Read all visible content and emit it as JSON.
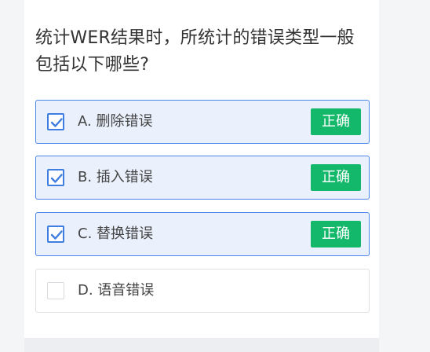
{
  "question": {
    "text": "统计WER结果时，所统计的错误类型一般包括以下哪些?"
  },
  "options": [
    {
      "label": "A. 删除错误",
      "selected": true,
      "badge": "正确"
    },
    {
      "label": "B. 插入错误",
      "selected": true,
      "badge": "正确"
    },
    {
      "label": "C. 替换错误",
      "selected": true,
      "badge": "正确"
    },
    {
      "label": "D. 语音错误",
      "selected": false,
      "badge": ""
    }
  ],
  "colors": {
    "accent": "#3f7de0",
    "selected_bg": "#eaf1fd",
    "correct_badge": "#13b86b"
  },
  "icons": {
    "checked": "checkbox-checked-icon",
    "unchecked": "checkbox-unchecked-icon"
  }
}
